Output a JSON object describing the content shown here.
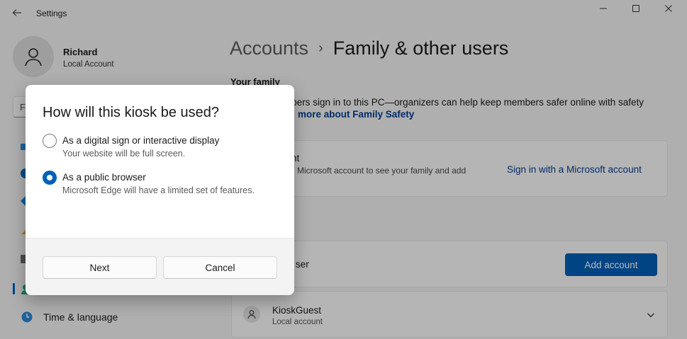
{
  "app": {
    "title": "Settings"
  },
  "user": {
    "name": "Richard",
    "account_type": "Local Account"
  },
  "search": {
    "placeholder_fragment": "F"
  },
  "nav": {
    "time_language": "Time & language"
  },
  "breadcrumb": {
    "parent": "Accounts",
    "separator": "›",
    "current": "Family & other users"
  },
  "family": {
    "section_title": "Your family",
    "description": "mbers sign in to this PC—organizers can help keep members safer online with safety",
    "link": "more about Family Safety",
    "signin_title_fragment": "nt",
    "signin_desc_fragment": "Microsoft account to see your family and add",
    "signin_link": "Sign in with a Microsoft account"
  },
  "other_users": {
    "add_label_fragment": "ser",
    "add_button": "Add account",
    "kiosk_user": {
      "name": "KioskGuest",
      "type": "Local account"
    }
  },
  "dialog": {
    "title": "How will this kiosk be used?",
    "options": [
      {
        "label": "As a digital sign or interactive display",
        "description": "Your website will be full screen.",
        "selected": false
      },
      {
        "label": "As a public browser",
        "description": "Microsoft Edge will have a limited set of features.",
        "selected": true
      }
    ],
    "next_button": "Next",
    "cancel_button": "Cancel"
  },
  "colors": {
    "accent": "#005fb8",
    "link": "#003e92",
    "background": "#f3f3f3"
  }
}
